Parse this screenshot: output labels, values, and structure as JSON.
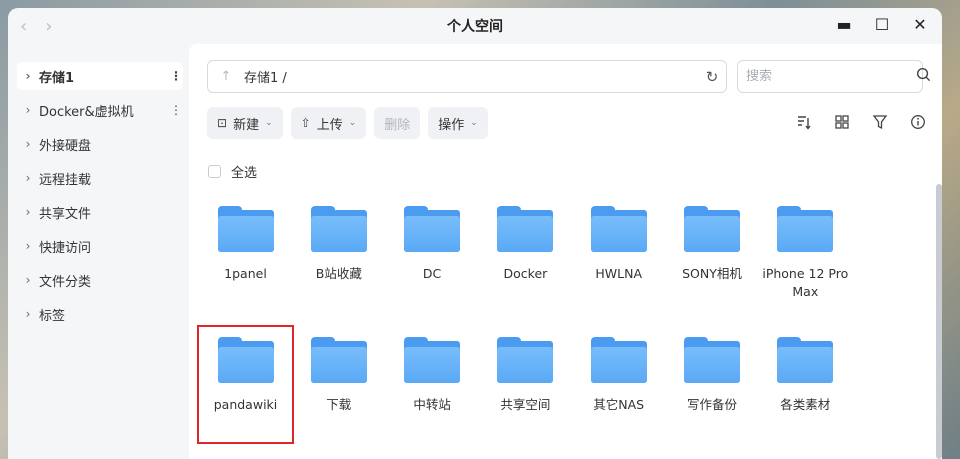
{
  "window": {
    "title": "个人空间",
    "nav_back": "‹",
    "nav_forward": "›",
    "minimize": "▬",
    "maximize": "☐",
    "close": "✕"
  },
  "sidebar": {
    "items": [
      {
        "label": "存储1",
        "active": true,
        "more": "⋮"
      },
      {
        "label": "Docker&虚拟机",
        "active": false,
        "more": "⋮"
      },
      {
        "label": "外接硬盘"
      },
      {
        "label": "远程挂载"
      },
      {
        "label": "共享文件"
      },
      {
        "label": "快捷访问"
      },
      {
        "label": "文件分类"
      },
      {
        "label": "标签"
      }
    ],
    "chevron": "›"
  },
  "pathbar": {
    "path": "存储1 /",
    "up": "↑",
    "refresh": "↻"
  },
  "search": {
    "placeholder": "搜索"
  },
  "toolbar": {
    "new_label": "新建",
    "upload_label": "上传",
    "delete_label": "删除",
    "operate_label": "操作",
    "caret": "⌄"
  },
  "select_all": "全选",
  "files": [
    {
      "name": "1panel"
    },
    {
      "name": "B站收藏"
    },
    {
      "name": "DC"
    },
    {
      "name": "Docker"
    },
    {
      "name": "HWLNA"
    },
    {
      "name": "SONY相机"
    },
    {
      "name": "iPhone 12 Pro Max"
    },
    {
      "name": "pandawiki",
      "selected": true
    },
    {
      "name": "下载"
    },
    {
      "name": "中转站"
    },
    {
      "name": "共享空间"
    },
    {
      "name": "其它NAS"
    },
    {
      "name": "写作备份"
    },
    {
      "name": "各类素材"
    }
  ]
}
